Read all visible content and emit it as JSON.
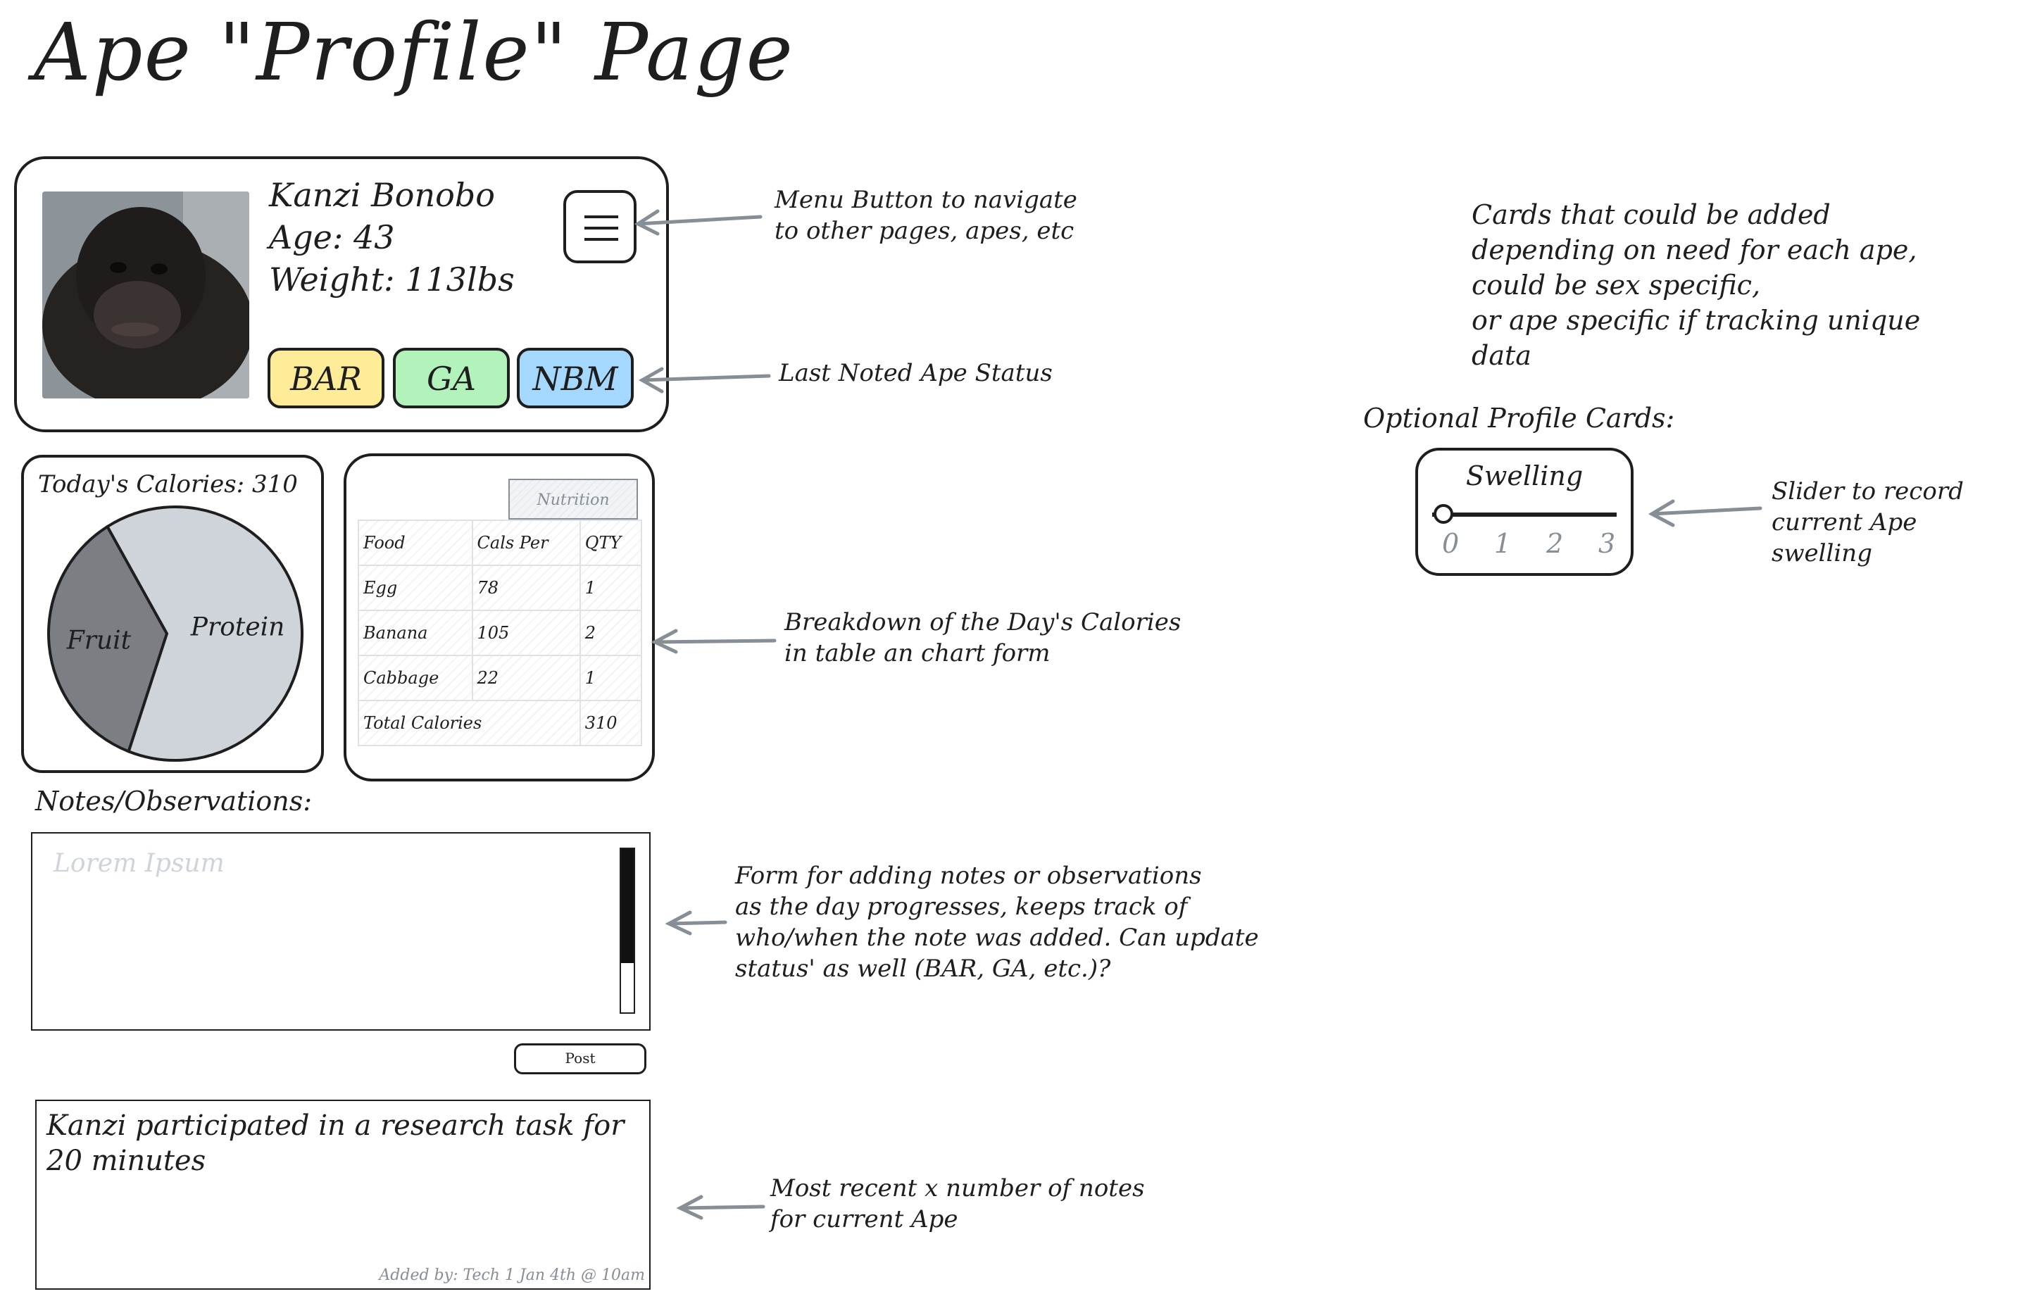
{
  "page": {
    "title": "Ape \"Profile\" Page"
  },
  "profile": {
    "name": "Kanzi Bonobo",
    "age": "Age: 43",
    "weight": "Weight: 113lbs",
    "statuses": [
      {
        "label": "BAR",
        "color": "#ffec99"
      },
      {
        "label": "GA",
        "color": "#b2f2bb"
      },
      {
        "label": "NBM",
        "color": "#a5d8ff"
      }
    ]
  },
  "calories": {
    "title": "Today's Calories: 310",
    "chart_data": {
      "type": "pie",
      "slices": [
        {
          "label": "Fruit",
          "value": 35,
          "color": "#7b7f84"
        },
        {
          "label": "Protein",
          "value": 65,
          "color": "#ced4da"
        }
      ]
    }
  },
  "nutrition": {
    "tab": "Nutrition",
    "headers": [
      "Food",
      "Cals Per",
      "QTY"
    ],
    "rows": [
      [
        "Egg",
        "78",
        "1"
      ],
      [
        "Banana",
        "105",
        "2"
      ],
      [
        "Cabbage",
        "22",
        "1"
      ]
    ],
    "total_label": "Total Calories",
    "total_value": "310"
  },
  "notes": {
    "label": "Notes/Observations:",
    "placeholder": "Lorem Ipsum",
    "post_label": "Post",
    "scroll_position": 0.7
  },
  "recent_note": {
    "text": "Kanzi participated in a research task for 20 minutes",
    "meta": "Added by: Tech 1 Jan 4th @ 10am"
  },
  "optional": {
    "label": "Optional Profile Cards:",
    "swelling": {
      "title": "Swelling",
      "ticks": [
        "0",
        "1",
        "2",
        "3"
      ],
      "value": 0
    }
  },
  "annotations": {
    "menu": "Menu Button to navigate\nto other pages, apes, etc",
    "status": "Last Noted Ape Status",
    "breakdown": "Breakdown of the Day's Calories\nin table an chart form",
    "form": "Form for adding notes or observations\nas the day progresses, keeps track of\nwho/when the note was added. Can update\nstatus' as well (BAR, GA, etc.)?",
    "recent": "Most recent x number of notes\nfor current Ape",
    "cards": "Cards that could be added\ndepending on need for each ape,\ncould be sex specific,\nor ape specific if tracking unique\ndata",
    "slider": "Slider to record\ncurrent Ape swelling"
  }
}
